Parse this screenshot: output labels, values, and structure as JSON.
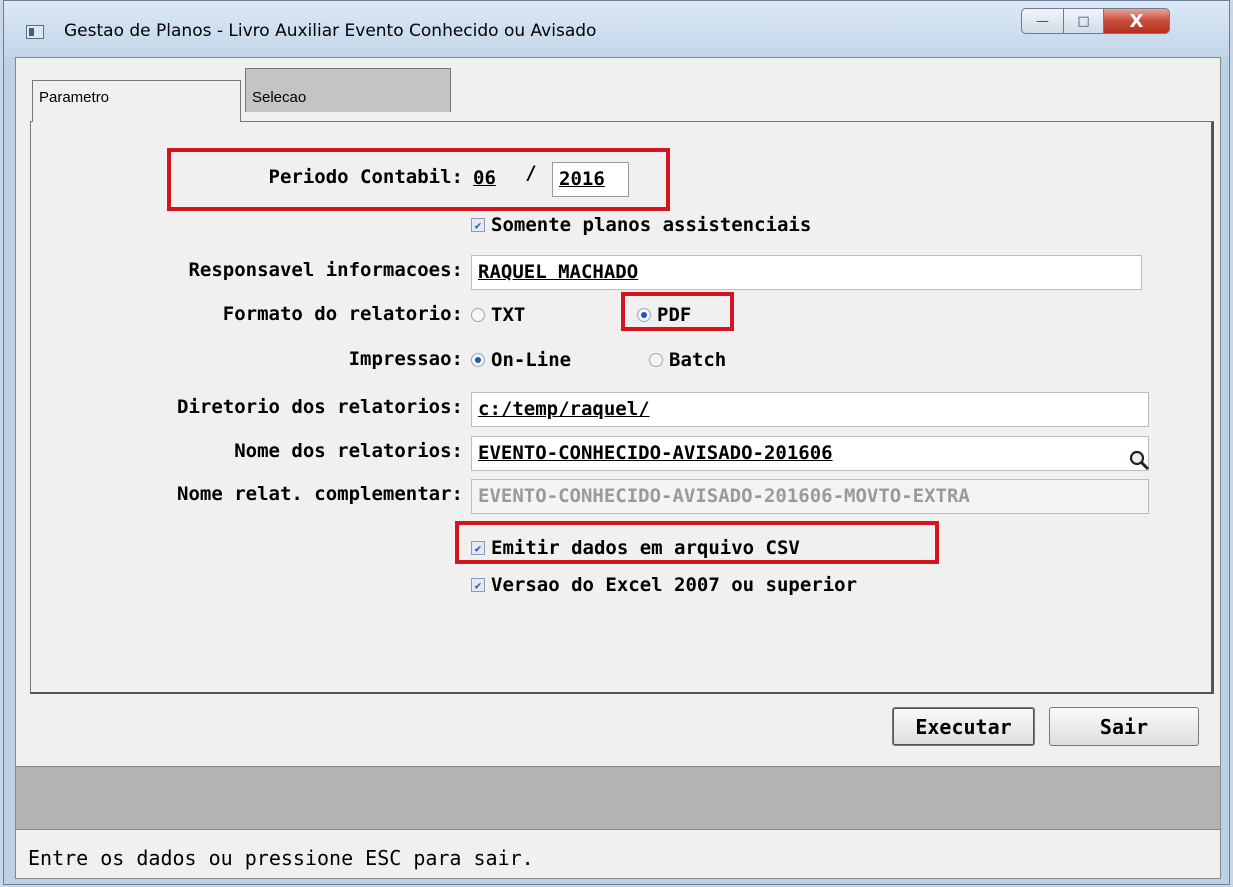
{
  "window": {
    "title": "Gestao de Planos - Livro Auxiliar Evento Conhecido ou Avisado",
    "buttons": {
      "minimize": "—",
      "maximize": "□",
      "close": "X"
    }
  },
  "tabs": [
    {
      "label": "Parametro",
      "active": true
    },
    {
      "label": "Selecao",
      "active": false
    }
  ],
  "form": {
    "periodo_label": "Periodo Contabil:",
    "periodo_mes": "06",
    "periodo_sep": "/",
    "periodo_ano": "2016",
    "somente_planos_label": "Somente planos assistenciais",
    "somente_planos_checked": true,
    "responsavel_label": "Responsavel informacoes:",
    "responsavel_value": "RAQUEL MACHADO",
    "formato_label": "Formato do relatorio:",
    "formato_options": [
      "TXT",
      "PDF"
    ],
    "formato_selected": "PDF",
    "impressao_label": "Impressao:",
    "impressao_options": [
      "On-Line",
      "Batch"
    ],
    "impressao_selected": "On-Line",
    "diretorio_label": "Diretorio dos relatorios:",
    "diretorio_value": "c:/temp/raquel/",
    "nome_label": "Nome dos relatorios:",
    "nome_value": "EVENTO-CONHECIDO-AVISADO-201606",
    "nome_compl_label": "Nome relat. complementar:",
    "nome_compl_value": "EVENTO-CONHECIDO-AVISADO-201606-MOVTO-EXTRA",
    "csv_label": "Emitir dados em arquivo CSV",
    "csv_checked": true,
    "excel_label": "Versao do Excel 2007 ou superior",
    "excel_checked": true
  },
  "buttons": {
    "executar": "Executar",
    "sair": "Sair"
  },
  "status": "Entre os dados ou pressione ESC para sair.",
  "colors": {
    "highlight": "#d4141e",
    "accent": "#1d57b8"
  }
}
